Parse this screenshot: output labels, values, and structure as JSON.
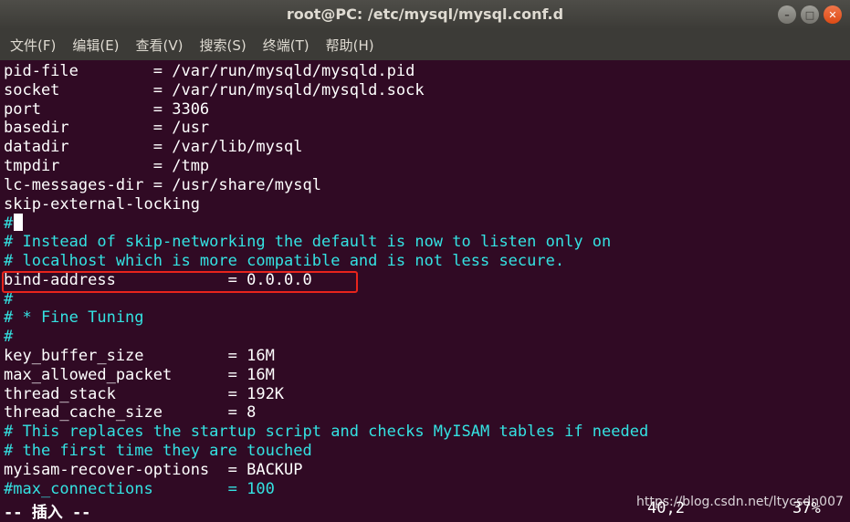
{
  "window": {
    "title": "root@PC: /etc/mysql/mysql.conf.d",
    "controls": {
      "minimize": "–",
      "maximize": "□",
      "close": "✕"
    }
  },
  "menu": [
    "文件(F)",
    "编辑(E)",
    "查看(V)",
    "搜索(S)",
    "终端(T)",
    "帮助(H)"
  ],
  "editor": {
    "lines": [
      {
        "text": "pid-file        = /var/run/mysqld/mysqld.pid",
        "type": "setting"
      },
      {
        "text": "socket          = /var/run/mysqld/mysqld.sock",
        "type": "setting"
      },
      {
        "text": "port            = 3306",
        "type": "setting"
      },
      {
        "text": "basedir         = /usr",
        "type": "setting"
      },
      {
        "text": "datadir         = /var/lib/mysql",
        "type": "setting"
      },
      {
        "text": "tmpdir          = /tmp",
        "type": "setting"
      },
      {
        "text": "lc-messages-dir = /usr/share/mysql",
        "type": "setting"
      },
      {
        "text": "skip-external-locking",
        "type": "setting"
      },
      {
        "text": "#",
        "type": "comment"
      },
      {
        "text": "# Instead of skip-networking the default is now to listen only on",
        "type": "comment"
      },
      {
        "text": "# localhost which is more compatible and is not less secure.",
        "type": "comment"
      },
      {
        "text": "bind-address            = 0.0.0.0",
        "type": "setting"
      },
      {
        "text": "#",
        "type": "comment"
      },
      {
        "text": "# * Fine Tuning",
        "type": "comment"
      },
      {
        "text": "#",
        "type": "comment"
      },
      {
        "text": "key_buffer_size         = 16M",
        "type": "setting"
      },
      {
        "text": "max_allowed_packet      = 16M",
        "type": "setting"
      },
      {
        "text": "thread_stack            = 192K",
        "type": "setting"
      },
      {
        "text": "thread_cache_size       = 8",
        "type": "setting"
      },
      {
        "text": "# This replaces the startup script and checks MyISAM tables if needed",
        "type": "comment"
      },
      {
        "text": "# the first time they are touched",
        "type": "comment"
      },
      {
        "text": "myisam-recover-options  = BACKUP",
        "type": "setting"
      },
      {
        "text": "#max_connections        = 100",
        "type": "comment"
      }
    ],
    "cursor_line": 9,
    "highlighted_line": 12
  },
  "status": {
    "mode": "-- 插入 --",
    "position": "40,2",
    "percent": "37%"
  },
  "watermark": "https://blog.csdn.net/ltycsdn007",
  "colors": {
    "terminal_bg": "#300a24",
    "text": "#ffffff",
    "comment": "#34e2e2",
    "highlight_border": "#e8241c",
    "titlebar": "#3c3b37"
  }
}
